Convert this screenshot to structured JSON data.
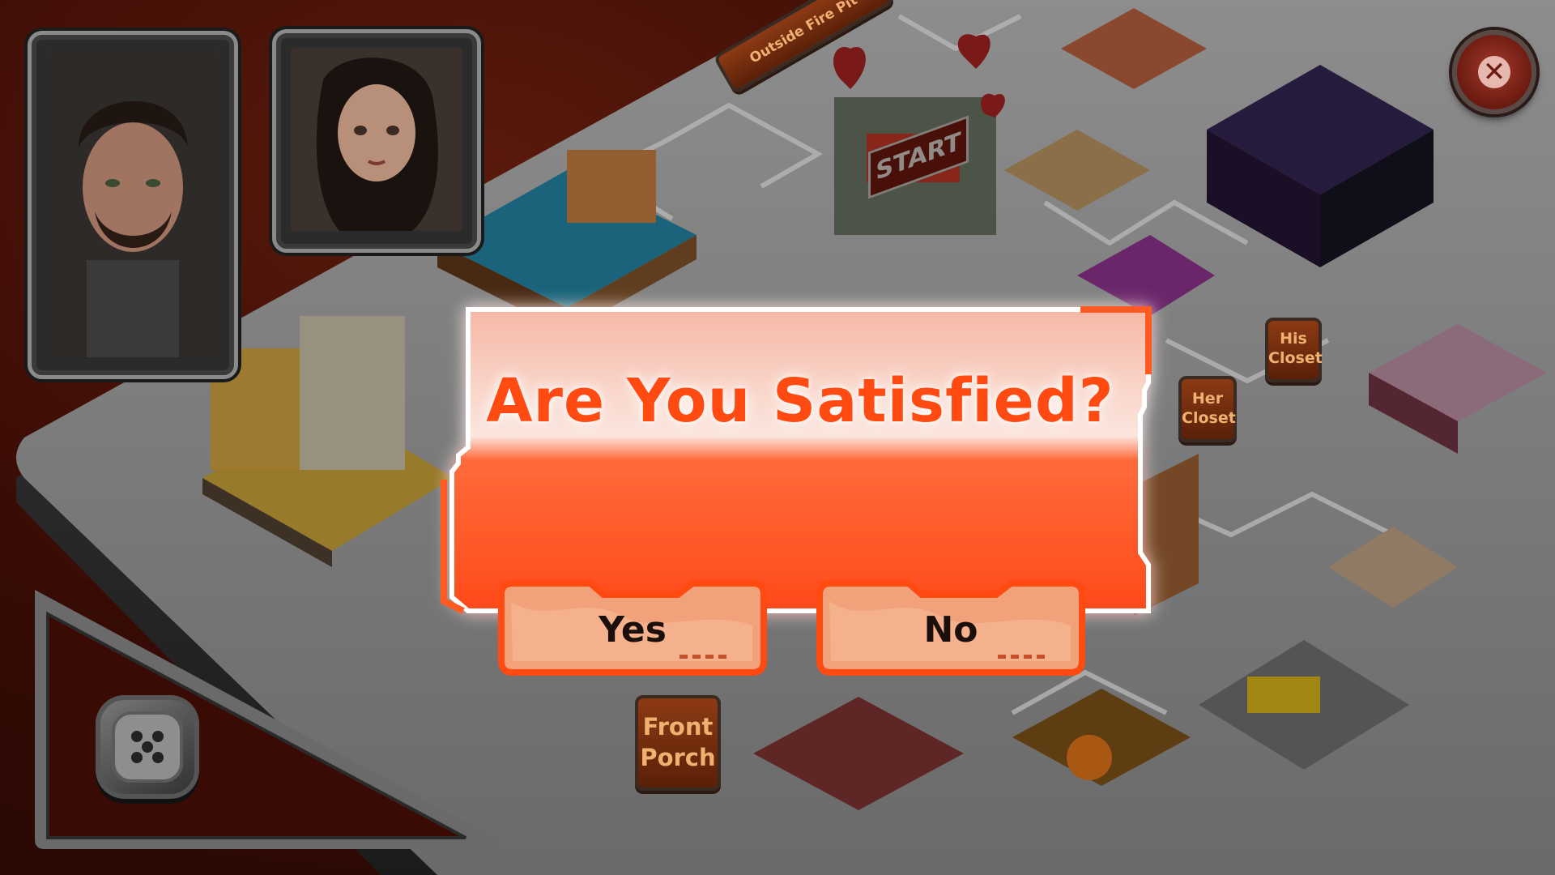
{
  "dialog": {
    "title": "Are You Satisfied?",
    "yes_label": "Yes",
    "no_label": "No"
  },
  "board_signs": {
    "outside_fire_pit": "Outside Fire Pit",
    "start": "START",
    "his_closet_line1": "His",
    "his_closet_line2": "Closet",
    "her_closet_line1": "Her",
    "her_closet_line2": "Closet",
    "front_porch_line1": "Front",
    "front_porch_line2": "Porch"
  },
  "players": [
    {
      "name": "male-player-portrait"
    },
    {
      "name": "female-player-portrait"
    }
  ],
  "icons": {
    "close": "close-icon",
    "dice": "dice-icon"
  },
  "colors": {
    "accent": "#ff4a12",
    "button_fill": "#f2a27a",
    "background": "#3a0c05"
  }
}
